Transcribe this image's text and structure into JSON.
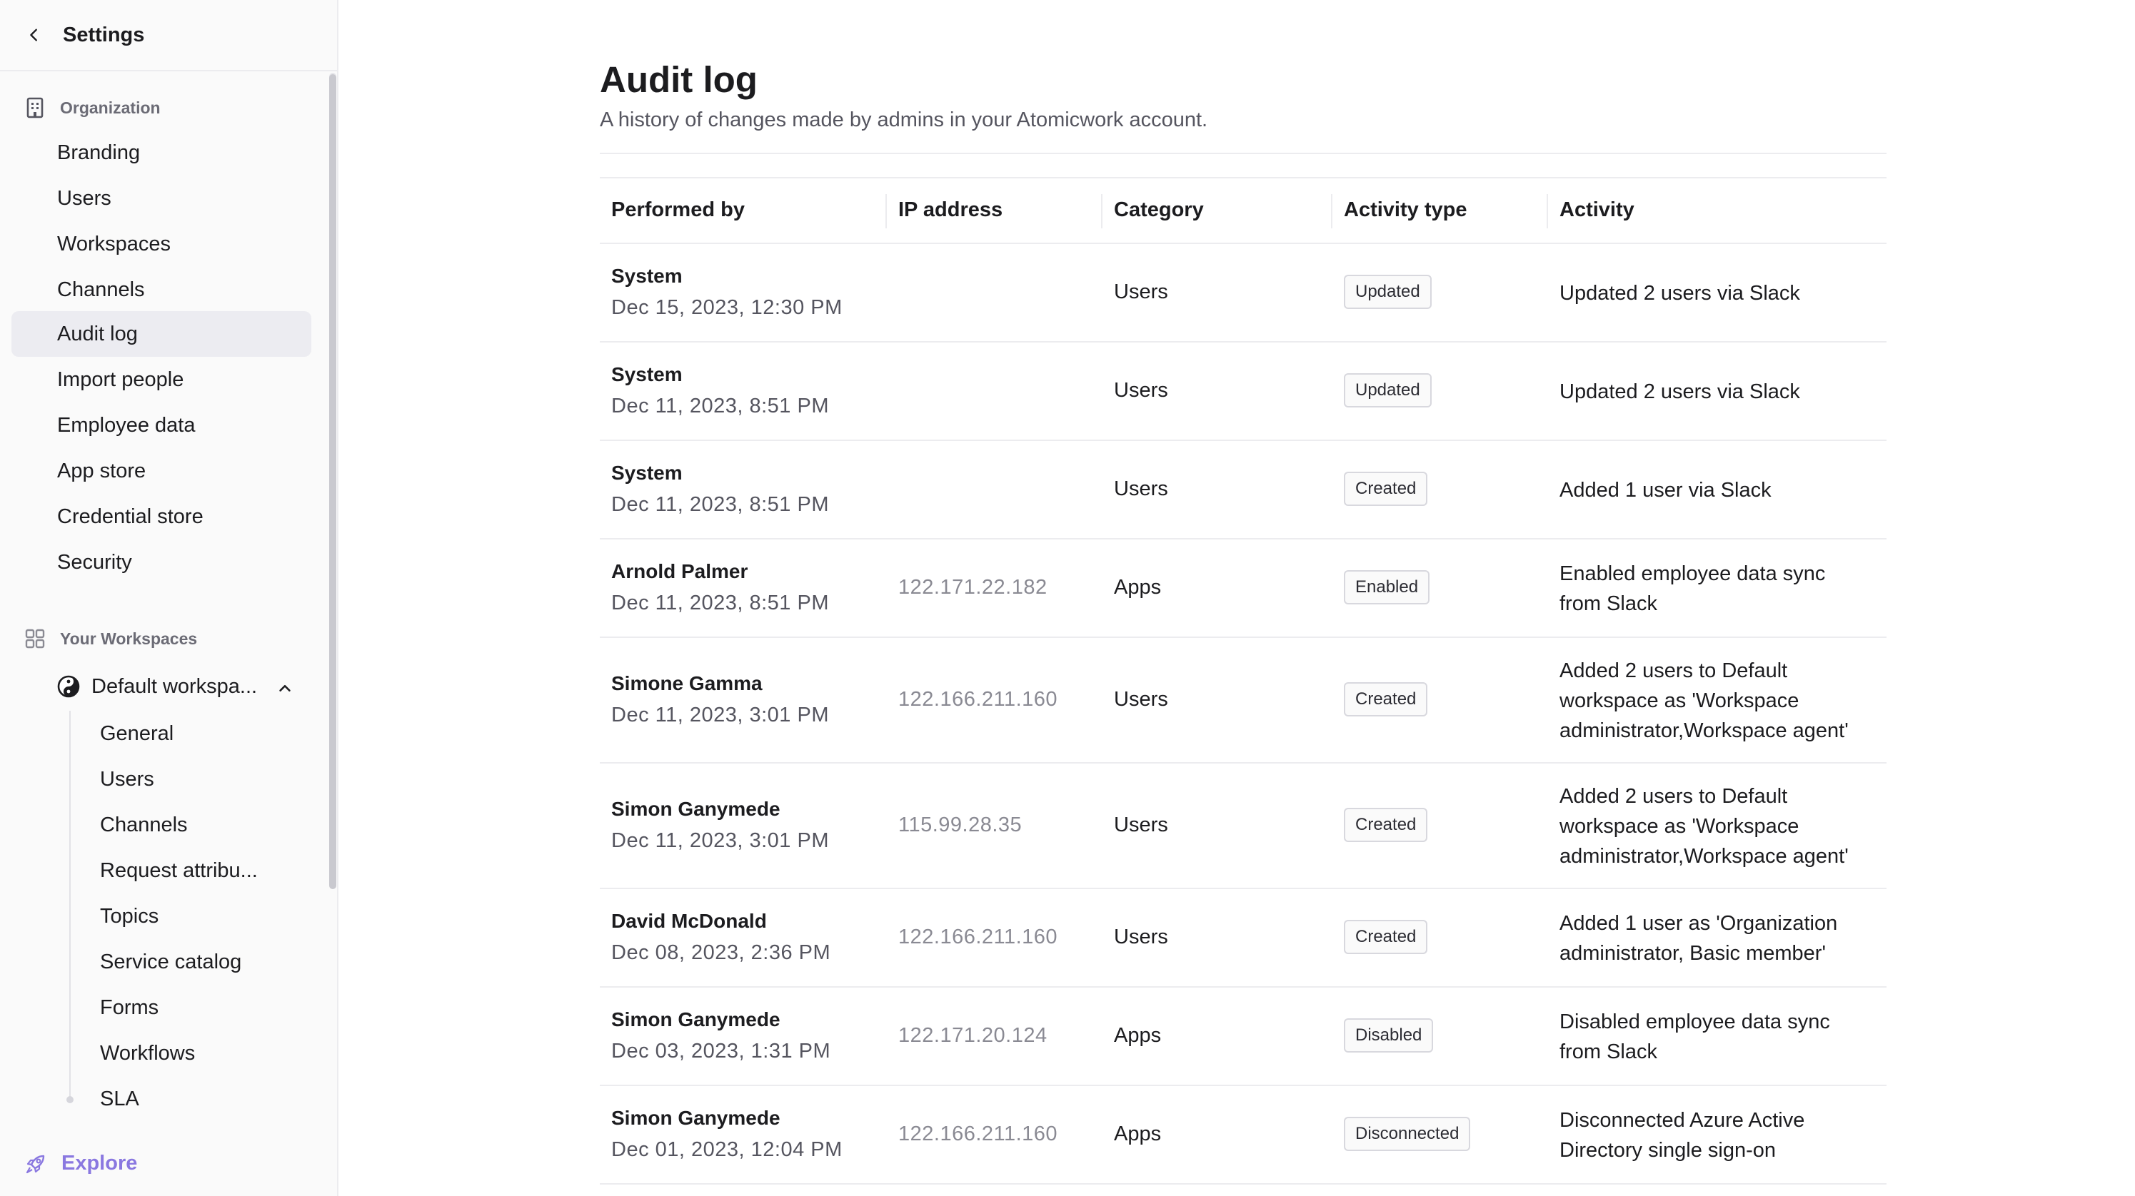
{
  "sidebar": {
    "title": "Settings",
    "organization": {
      "heading": "Organization",
      "items": [
        {
          "label": "Branding"
        },
        {
          "label": "Users"
        },
        {
          "label": "Workspaces"
        },
        {
          "label": "Channels"
        },
        {
          "label": "Audit log",
          "active": true
        },
        {
          "label": "Import people"
        },
        {
          "label": "Employee data"
        },
        {
          "label": "App store"
        },
        {
          "label": "Credential store"
        },
        {
          "label": "Security"
        }
      ]
    },
    "workspaces": {
      "heading": "Your Workspaces",
      "workspace_name": "Default workspa...",
      "items": [
        {
          "label": "General"
        },
        {
          "label": "Users"
        },
        {
          "label": "Channels"
        },
        {
          "label": "Request attribu..."
        },
        {
          "label": "Topics"
        },
        {
          "label": "Service catalog"
        },
        {
          "label": "Forms"
        },
        {
          "label": "Workflows"
        },
        {
          "label": "SLA"
        }
      ]
    },
    "explore_label": "Explore"
  },
  "main": {
    "title": "Audit log",
    "subtitle": "A history of changes made by admins in your Atomicwork account.",
    "columns": [
      "Performed by",
      "IP address",
      "Category",
      "Activity type",
      "Activity"
    ],
    "rows": [
      {
        "name": "System",
        "date": "Dec 15, 2023, 12:30 PM",
        "ip": "",
        "category": "Users",
        "type": "Updated",
        "activity": [
          "Updated 2 users via Slack"
        ]
      },
      {
        "name": "System",
        "date": "Dec 11, 2023, 8:51 PM",
        "ip": "",
        "category": "Users",
        "type": "Updated",
        "activity": [
          "Updated 2 users via Slack"
        ]
      },
      {
        "name": "System",
        "date": "Dec 11, 2023, 8:51 PM",
        "ip": "",
        "category": "Users",
        "type": "Created",
        "activity": [
          "Added 1 user via Slack"
        ]
      },
      {
        "name": "Arnold Palmer",
        "date": "Dec 11, 2023, 8:51 PM",
        "ip": "122.171.22.182",
        "category": "Apps",
        "type": "Enabled",
        "activity": [
          "Enabled employee data sync",
          "from Slack"
        ]
      },
      {
        "name": "Simone Gamma",
        "date": "Dec 11, 2023, 3:01 PM",
        "ip": "122.166.211.160",
        "category": "Users",
        "type": "Created",
        "activity": [
          "Added 2 users to Default",
          "workspace as 'Workspace",
          "administrator,Workspace agent'"
        ]
      },
      {
        "name": "Simon Ganymede",
        "date": "Dec 11, 2023, 3:01 PM",
        "ip": "115.99.28.35",
        "category": "Users",
        "type": "Created",
        "activity": [
          "Added 2 users to Default",
          "workspace as 'Workspace",
          "administrator,Workspace agent'"
        ]
      },
      {
        "name": "David McDonald",
        "date": "Dec 08, 2023, 2:36 PM",
        "ip": "122.166.211.160",
        "category": "Users",
        "type": "Created",
        "activity": [
          "Added 1 user as 'Organization",
          "administrator, Basic member'"
        ]
      },
      {
        "name": "Simon Ganymede",
        "date": "Dec 03, 2023, 1:31 PM",
        "ip": "122.171.20.124",
        "category": "Apps",
        "type": "Disabled",
        "activity": [
          "Disabled employee data sync",
          "from Slack"
        ]
      },
      {
        "name": "Simon Ganymede",
        "date": "Dec 01, 2023, 12:04 PM",
        "ip": "122.166.211.160",
        "category": "Apps",
        "type": "Disconnected",
        "activity": [
          "Disconnected Azure Active",
          "Directory single sign-on"
        ]
      }
    ]
  },
  "icons": {
    "back": "chevron-left-icon",
    "organization": "building-icon",
    "workspaces": "grid-icon",
    "workspace": "workspace-logo-icon",
    "collapse": "chevron-up-icon",
    "explore": "rocket-icon"
  },
  "colors": {
    "accent": "#8a78e0",
    "active_bg": "#ececf1",
    "border": "#ececef"
  }
}
